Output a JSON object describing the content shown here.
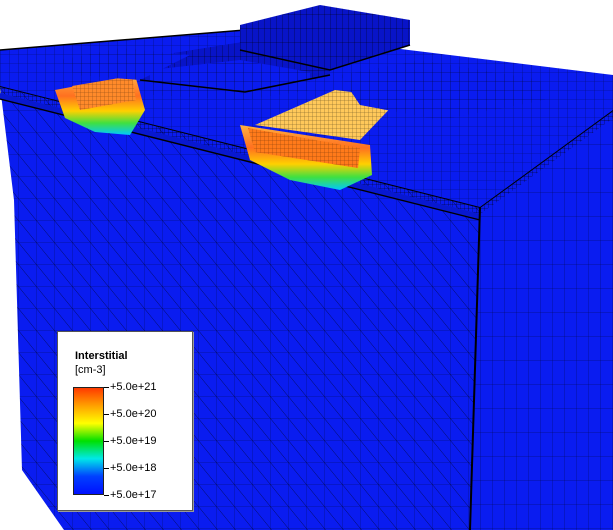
{
  "legend": {
    "title": "Interstitial",
    "unit": "[cm-3]",
    "ticks": [
      "+5.0e+21",
      "+5.0e+20",
      "+5.0e+19",
      "+5.0e+18",
      "+5.0e+17"
    ],
    "gradient": [
      "#ff3a00",
      "#ffa000",
      "#ffff00",
      "#00e000",
      "#00e8e8",
      "#0040ff",
      "#0010ff"
    ]
  },
  "colors": {
    "substrate": "#0a1cf0",
    "substrate_dark": "#0814c8",
    "mesh_line": "#000000",
    "hot_region": "#ff7a1a",
    "warm_region": "#ffc85a"
  }
}
